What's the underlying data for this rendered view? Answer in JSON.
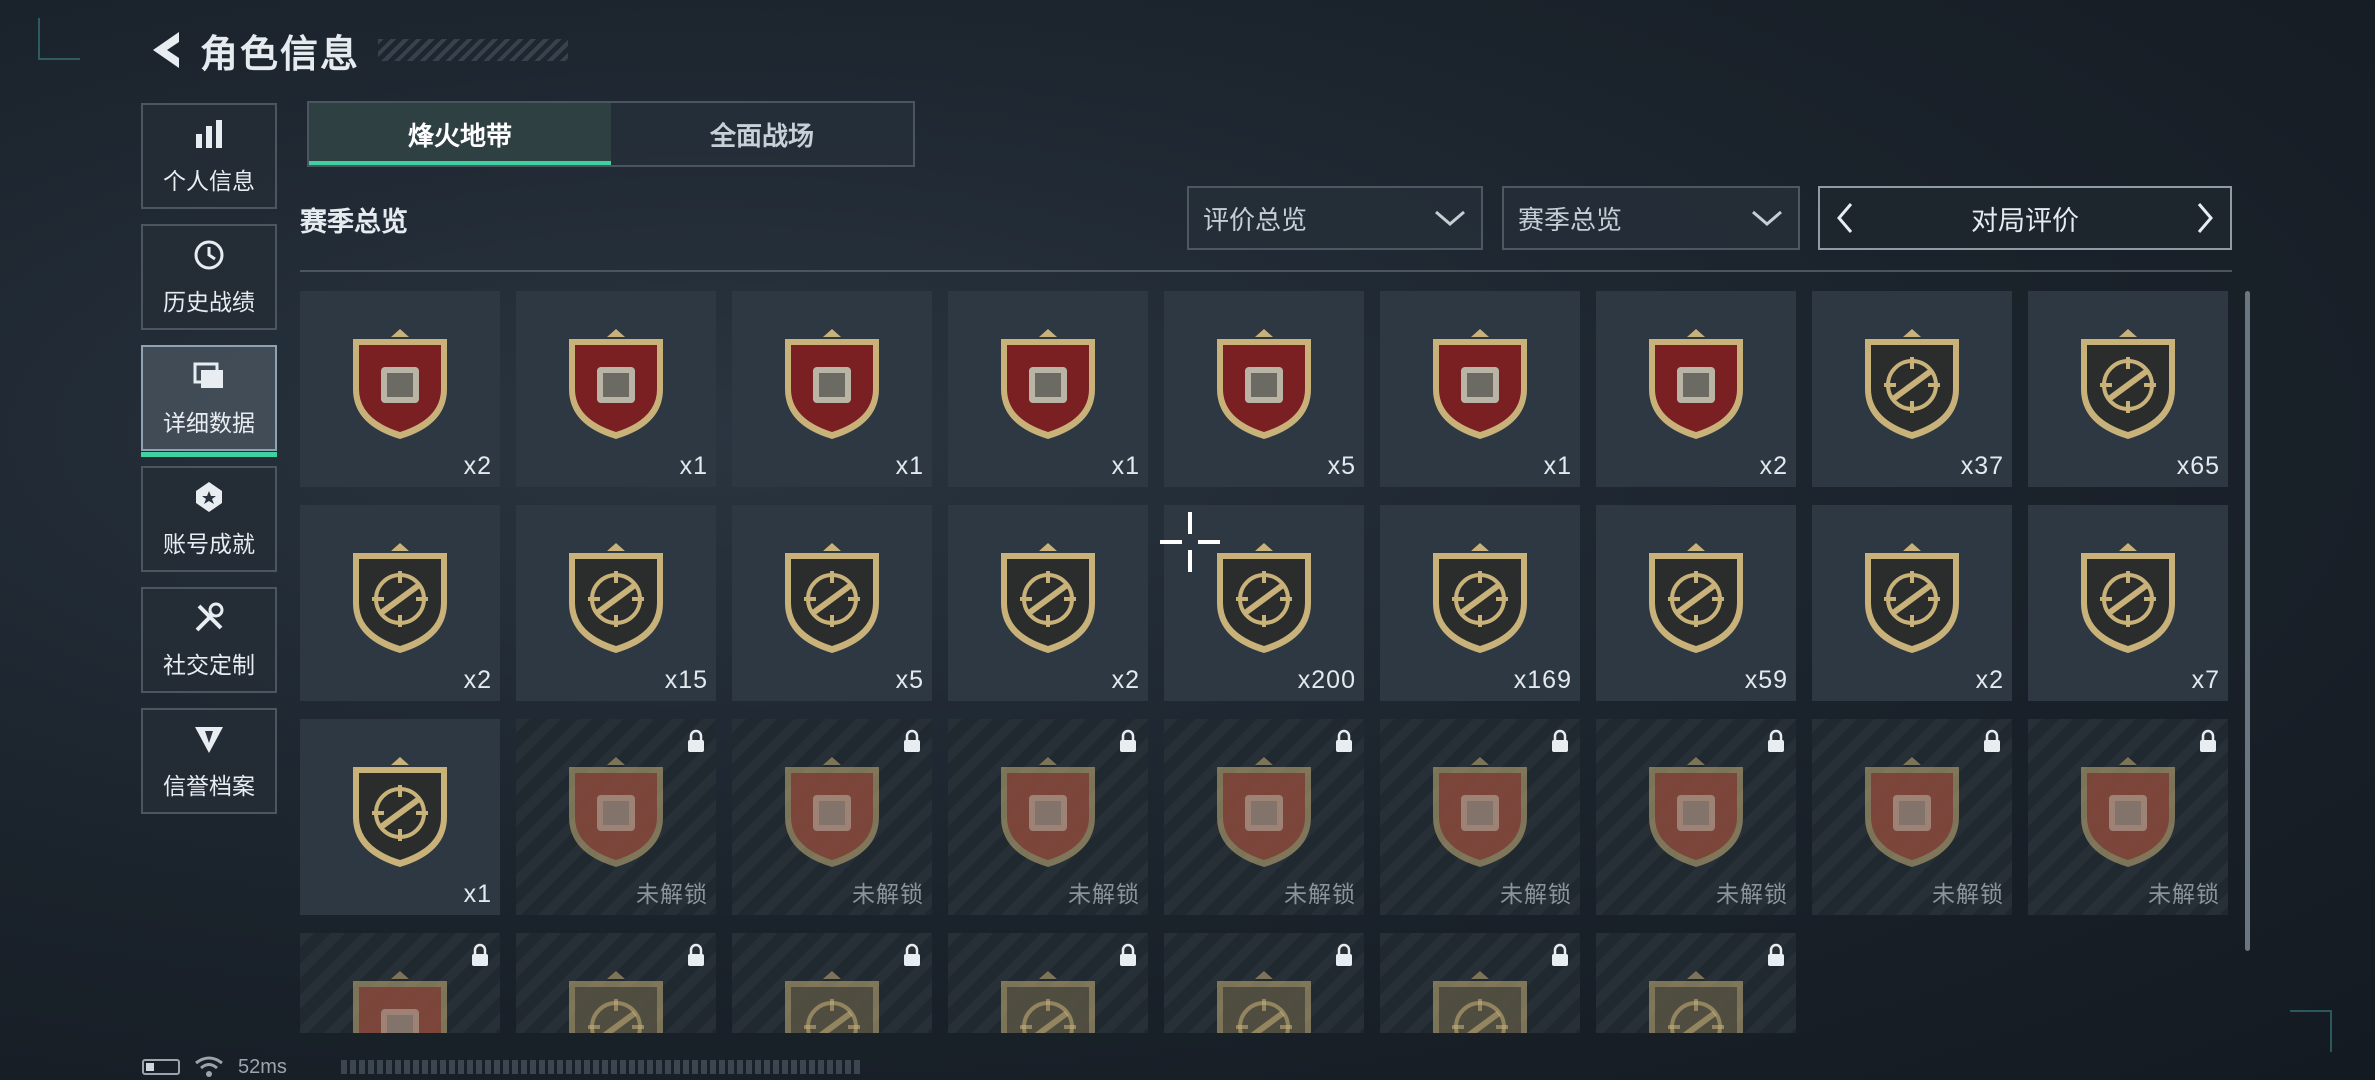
{
  "header": {
    "title": "角色信息"
  },
  "nav": [
    {
      "label": "个人信息",
      "icon": "bar-chart-icon",
      "active": false
    },
    {
      "label": "历史战绩",
      "icon": "history-icon",
      "active": false
    },
    {
      "label": "详细数据",
      "icon": "folder-icon",
      "active": true
    },
    {
      "label": "账号成就",
      "icon": "achievement-icon",
      "active": false
    },
    {
      "label": "社交定制",
      "icon": "tools-icon",
      "active": false
    },
    {
      "label": "信誉档案",
      "icon": "credit-icon",
      "active": false
    }
  ],
  "tabs": [
    {
      "label": "烽火地带",
      "active": true
    },
    {
      "label": "全面战场",
      "active": false
    }
  ],
  "section": {
    "title": "赛季总览"
  },
  "filters": {
    "rating_dropdown": "评价总览",
    "season_dropdown": "赛季总览",
    "pager_label": "对局评价"
  },
  "status_bar": {
    "ping": "52ms"
  },
  "colors": {
    "accent": "#3fd1a0",
    "badge_red": "#7a1f22",
    "badge_gold": "#c9b27a",
    "badge_dark": "#2a2d2b"
  },
  "badges": [
    {
      "item": "diamond-icon",
      "style": "red",
      "count": "x2",
      "locked": false
    },
    {
      "item": "tank-icon",
      "style": "red",
      "count": "x1",
      "locked": false
    },
    {
      "item": "server-icon",
      "style": "red",
      "count": "x1",
      "locked": false
    },
    {
      "item": "case-icon",
      "style": "red",
      "count": "x1",
      "locked": false
    },
    {
      "item": "chip-icon",
      "style": "red",
      "count": "x5",
      "locked": false
    },
    {
      "item": "robot-icon",
      "style": "red",
      "count": "x1",
      "locked": false
    },
    {
      "item": "painting-icon",
      "style": "red",
      "count": "x2",
      "locked": false
    },
    {
      "item": "rifle-crosshair-icon",
      "style": "gold",
      "count": "x37",
      "locked": false
    },
    {
      "item": "smg-crosshair-icon",
      "style": "gold",
      "count": "x65",
      "locked": false
    },
    {
      "item": "sniper-crosshair-icon",
      "style": "gold",
      "count": "x2",
      "locked": false
    },
    {
      "item": "assault-crosshair-icon",
      "style": "gold",
      "count": "x15",
      "locked": false
    },
    {
      "item": "shotgun-crosshair-icon",
      "style": "gold",
      "count": "x5",
      "locked": false
    },
    {
      "item": "pistol-crosshair-icon",
      "style": "gold",
      "count": "x2",
      "locked": false
    },
    {
      "item": "knife-crosshair-icon",
      "style": "gold",
      "count": "x200",
      "locked": false
    },
    {
      "item": "explosion-icon",
      "style": "gold",
      "count": "x169",
      "locked": false
    },
    {
      "item": "wreath-emblem-icon",
      "style": "gold",
      "count": "x59",
      "locked": false
    },
    {
      "item": "wing-emblem-icon",
      "style": "gold",
      "count": "x2",
      "locked": false
    },
    {
      "item": "operator-icon",
      "style": "gold",
      "count": "x7",
      "locked": false
    },
    {
      "item": "operator-portrait-icon",
      "style": "gold",
      "count": "x1",
      "locked": false
    },
    {
      "item": "orb-icon",
      "style": "red",
      "count": "未解锁",
      "locked": true
    },
    {
      "item": "terminal-icon",
      "style": "red",
      "count": "未解锁",
      "locked": true
    },
    {
      "item": "plate-icon",
      "style": "red",
      "count": "未解锁",
      "locked": true
    },
    {
      "item": "reactor-icon",
      "style": "red",
      "count": "未解锁",
      "locked": true
    },
    {
      "item": "egg-icon",
      "style": "red",
      "count": "未解锁",
      "locked": true
    },
    {
      "item": "chessboard-icon",
      "style": "red",
      "count": "未解锁",
      "locked": true
    },
    {
      "item": "engine-icon",
      "style": "red",
      "count": "未解锁",
      "locked": true
    },
    {
      "item": "canister-icon",
      "style": "red",
      "count": "未解锁",
      "locked": true
    },
    {
      "item": "skull-creature-icon",
      "style": "red",
      "count": "",
      "locked": true
    },
    {
      "item": "rifle-crosshair-icon",
      "style": "gold",
      "count": "",
      "locked": true
    },
    {
      "item": "soldier-icon",
      "style": "gold",
      "count": "",
      "locked": true
    },
    {
      "item": "mask-crosshair-icon",
      "style": "gold",
      "count": "",
      "locked": true
    },
    {
      "item": "helmet-crosshair-icon",
      "style": "gold",
      "count": "",
      "locked": true
    },
    {
      "item": "operator-icon",
      "style": "gold",
      "count": "",
      "locked": true
    },
    {
      "item": "skull-icon",
      "style": "gold",
      "count": "",
      "locked": true
    }
  ]
}
